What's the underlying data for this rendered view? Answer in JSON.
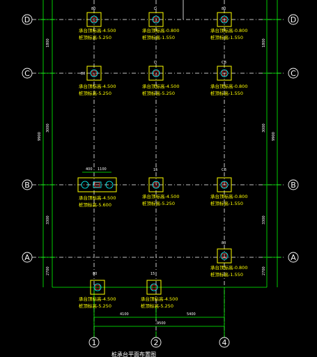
{
  "colors": {
    "background": "#000000",
    "grid_line": "#ffffff",
    "dimension": "#00ff00",
    "pile_cap": "#ffff00",
    "pile": "#00ffff",
    "column": "#ff3333",
    "note_text": "#ffff00",
    "axis_bubble": "#ffffff"
  },
  "axes": {
    "rows": [
      {
        "id": "D",
        "label": "D"
      },
      {
        "id": "C",
        "label": "C"
      },
      {
        "id": "B",
        "label": "B"
      },
      {
        "id": "A",
        "label": "A"
      }
    ],
    "columns": [
      {
        "id": "1",
        "label": "1"
      },
      {
        "id": "2",
        "label": "2"
      },
      {
        "id": "4",
        "label": "4"
      }
    ]
  },
  "dimensions": {
    "left_segments": [
      "1800",
      "3000",
      "3300",
      "2700"
    ],
    "left_total": "9900",
    "right_segments": [
      "1800",
      "3000",
      "3300",
      "2700"
    ],
    "right_total": "9900",
    "bottom_segments": [
      "4100",
      "5400"
    ],
    "bottom_total": "9500",
    "double_pile_spacing": [
      "400",
      "1100"
    ]
  },
  "caps": [
    {
      "id": "cap-d1",
      "tag": "80",
      "line1": "承台顶标高-4.500",
      "line2": "桩顶标高-5.250"
    },
    {
      "id": "cap-d2",
      "tag": "D",
      "line1": "承台顶标高-0.800",
      "line2": "桩顶标高-1.550"
    },
    {
      "id": "cap-d4",
      "tag": "80",
      "line1": "承台顶标高-0.800",
      "line2": "桩顶标高-1.550"
    },
    {
      "id": "cap-c1",
      "tag": "80",
      "line1": "承台顶标高-4.500",
      "line2": "桩顶标高-5.250"
    },
    {
      "id": "cap-c2",
      "tag": "D",
      "line1": "承台顶标高-4.500",
      "line2": "桩顶标高-5.250"
    },
    {
      "id": "cap-c4",
      "tag": "CB",
      "line1": "承台顶标高-0.800",
      "line2": "桩顶标高-1.550"
    },
    {
      "id": "cap-b1",
      "tag": "",
      "line1": "承台顶标高-4.500",
      "line2": "桩顶标高-5.600"
    },
    {
      "id": "cap-b2",
      "tag": "15",
      "line1": "承台顶标高-4.500",
      "line2": "桩顶标高-5.250"
    },
    {
      "id": "cap-b4",
      "tag": "CB",
      "line1": "承台顶标高-0.800",
      "line2": "桩顶标高-1.550"
    },
    {
      "id": "cap-a4",
      "tag": "80",
      "line1": "承台顶标高-0.800",
      "line2": "桩顶标高-1.550"
    },
    {
      "id": "cap-e1",
      "tag": "80",
      "line1": "承台顶标高-4.500",
      "line2": "桩顶标高-5.250"
    },
    {
      "id": "cap-e2",
      "tag": "15",
      "line1": "承台顶标高-4.500",
      "line2": "桩顶标高-5.250"
    }
  ],
  "drawing_title": "桩承台平面布置图"
}
